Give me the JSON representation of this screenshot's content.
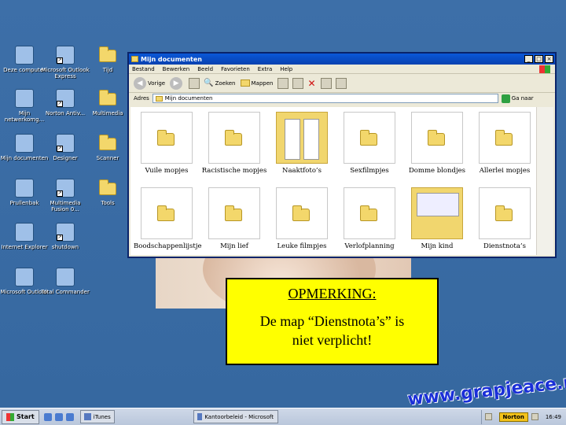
{
  "desktop": {
    "icons": [
      {
        "label": "Deze computer",
        "icon": "my-computer-icon"
      },
      {
        "label": "Microsoft Outlook Express",
        "icon": "outlook-express-icon",
        "shortcut": true
      },
      {
        "label": "Tijd",
        "icon": "folder-icon"
      },
      {
        "label": "Mijn netwerkomg...",
        "icon": "network-places-icon"
      },
      {
        "label": "Norton Antiv...",
        "icon": "norton-icon",
        "shortcut": true
      },
      {
        "label": "Multimedia",
        "icon": "folder-icon"
      },
      {
        "label": "Mijn documenten",
        "icon": "my-documents-icon"
      },
      {
        "label": "Designer",
        "icon": "designer-icon",
        "shortcut": true
      },
      {
        "label": "Scanner",
        "icon": "folder-icon"
      },
      {
        "label": "Prullenbak",
        "icon": "recycle-bin-icon"
      },
      {
        "label": "Multimedia Fusion 0...",
        "icon": "multimedia-fusion-icon",
        "shortcut": true
      },
      {
        "label": "Tools",
        "icon": "folder-icon"
      },
      {
        "label": "Internet Explorer",
        "icon": "internet-explorer-icon"
      },
      {
        "label": "shutdown",
        "icon": "shutdown-icon",
        "shortcut": true
      },
      {
        "label": "Microsoft Outlook",
        "icon": "outlook-icon"
      },
      {
        "label": "Total Commander",
        "icon": "total-commander-icon"
      }
    ]
  },
  "window": {
    "title": "Mijn documenten",
    "menu": [
      "Bestand",
      "Bewerken",
      "Beeld",
      "Favorieten",
      "Extra",
      "Help"
    ],
    "toolbar": {
      "back": "Vorige",
      "search": "Zoeken",
      "folders": "Mappen"
    },
    "address_label": "Adres",
    "address_value": "Mijn documenten",
    "go_label": "Ga naar",
    "items": [
      {
        "label": "Vuile mopjes",
        "kind": "folder"
      },
      {
        "label": "Racistische mopjes",
        "kind": "folder"
      },
      {
        "label": "Naaktfoto’s",
        "kind": "folder-highlight"
      },
      {
        "label": "Sexfilmpjes",
        "kind": "folder"
      },
      {
        "label": "Domme blondjes",
        "kind": "folder"
      },
      {
        "label": "Allerlei mopjes",
        "kind": "folder"
      },
      {
        "label": "Boodschappenlijstje",
        "kind": "folder"
      },
      {
        "label": "Mijn lief",
        "kind": "folder"
      },
      {
        "label": "Leuke filmpjes",
        "kind": "folder"
      },
      {
        "label": "Verlofplanning",
        "kind": "folder"
      },
      {
        "label": "Mijn kind",
        "kind": "folder-highlight-screen"
      },
      {
        "label": "Dienstnota’s",
        "kind": "folder"
      }
    ]
  },
  "note": {
    "heading": "OPMERKING:",
    "line1": "De map “Dienstnota’s” is",
    "line2": "niet verplicht!"
  },
  "watermark": "www.grapjeace.nl",
  "taskbar": {
    "start_label": "Start",
    "items": [
      "iTunes",
      "Kantoorbeleid - Microsoft PowerP..."
    ],
    "norton": "Norton",
    "clock": "16:49"
  }
}
